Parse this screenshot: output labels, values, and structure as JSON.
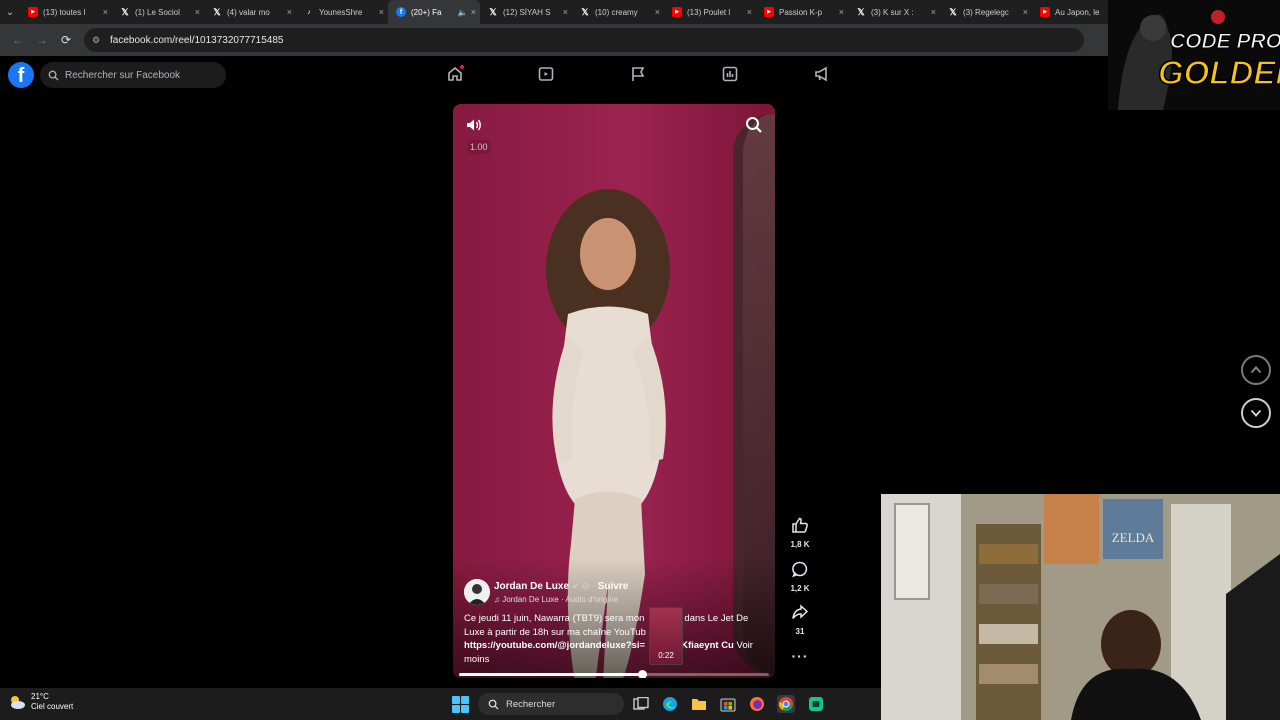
{
  "browser": {
    "tabs": [
      {
        "label": "(13) toutes l",
        "icon": "youtube-icon",
        "color": "#ff0000"
      },
      {
        "label": "(1) Le Sociol",
        "icon": "x-icon",
        "color": "#000000"
      },
      {
        "label": "(4) valar mo",
        "icon": "x-icon",
        "color": "#000000"
      },
      {
        "label": "YounesShre",
        "icon": "tiktok-icon",
        "color": "#000000"
      },
      {
        "label": "(20+) Fa",
        "icon": "facebook-icon",
        "color": "#1877f2",
        "active": true
      },
      {
        "label": "(12) SİYAH S",
        "icon": "x-icon",
        "color": "#000000"
      },
      {
        "label": "(10) creamy",
        "icon": "x-icon",
        "color": "#000000"
      },
      {
        "label": "(13) Poulet l",
        "icon": "youtube-icon",
        "color": "#ff0000"
      },
      {
        "label": "Passion K-p",
        "icon": "youtube-icon",
        "color": "#ff0000"
      },
      {
        "label": "(3) K sur X :",
        "icon": "x-icon",
        "color": "#000000"
      },
      {
        "label": "(3) Regelegc",
        "icon": "x-icon",
        "color": "#000000"
      },
      {
        "label": "Au Japon, le",
        "icon": "youtube-icon",
        "color": "#ff0000"
      }
    ],
    "url": "facebook.com/reel/1013732077715485"
  },
  "facebook": {
    "search_placeholder": "Rechercher sur Facebook",
    "logo_letter": "f",
    "accent": "#1877f2"
  },
  "reel": {
    "speed": "1.00",
    "author": "Jordan De Luxe",
    "follow_label": "Suivre",
    "audio": "Jordan De Luxe · Audio d'origine",
    "caption_line1": "Ce jeudi 11 juin, Nawarra (TBT9) sera mon",
    "caption_line1b": "dans Le Jet De",
    "caption_line2": "Luxe à partir de 18h sur ma chaîne YouTub",
    "caption_link": "https://youtube.com/@jordandeluxe?si=",
    "caption_link_end": "Kfiaeynt Cu",
    "more_label": "Voir moins",
    "preview_time": "0:22",
    "progress": 0.59,
    "likes": "1,8 K",
    "comments": "1,2 K",
    "shares": "31"
  },
  "overlay": {
    "logo_top": "CODE PROZIS",
    "logo_bottom": "GOLDENG"
  },
  "taskbar": {
    "temperature": "21°C",
    "weather": "Ciel couvert",
    "search": "Rechercher"
  }
}
